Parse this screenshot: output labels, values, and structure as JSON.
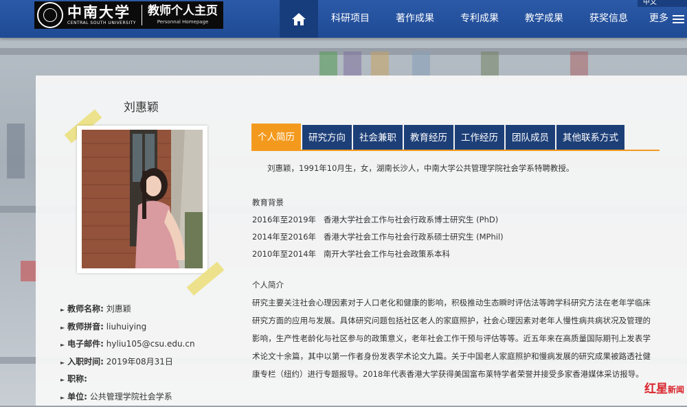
{
  "header": {
    "logo_cn": "中南大学",
    "logo_en": "CENTRAL SOUTH UNIVERSITY",
    "site_title": "教师个人主页",
    "site_title_en": "Personnal Homepage",
    "lang": "中文",
    "home_icon": "home-icon",
    "nav": [
      "科研项目",
      "著作成果",
      "专利成果",
      "教学成果",
      "获奖信息"
    ],
    "more": "更多",
    "colors": {
      "nav_bg": "#2b5aa8",
      "home_bg": "#173d7d"
    }
  },
  "profile": {
    "name": "刘惠颖",
    "fields": [
      {
        "label": "教师名称:",
        "value": "刘惠颖"
      },
      {
        "label": "教师拼音:",
        "value": "liuhuiying"
      },
      {
        "label": "电子邮件:",
        "value": "hyliu105@csu.edu.cn"
      },
      {
        "label": "入职时间:",
        "value": "2019年08月31日"
      },
      {
        "label": "职称:",
        "value": ""
      },
      {
        "label": "单位:",
        "value": "公共管理学院社会学系"
      }
    ]
  },
  "tabs": [
    "个人简历",
    "研究方向",
    "社会兼职",
    "教育经历",
    "工作经历",
    "团队成员",
    "其他联系方式"
  ],
  "active_tab": "个人简历",
  "resume": {
    "intro": "刘惠颖，1991年10月生，女，湖南长沙人，中南大学公共管理学院社会学系特聘教授。",
    "edu_title": "教育背景",
    "edu": [
      "2016年至2019年   香港大学社会工作与社会行政系博士研究生 (PhD)",
      "2014年至2016年   香港大学社会工作与社会行政系硕士研究生 (MPhil)",
      "2010年至2014年   南开大学社会工作与社会政策系本科"
    ],
    "bio_title": "个人简介",
    "bio": "研究主要关注社会心理因素对于人口老化和健康的影响，积极推动生态瞬时评估法等跨学科研究方法在老年学临床研究方面的应用与发展。具体研究问题包括社区老人的家庭照护，社会心理因素对老年人慢性病共病状况及管理的影响，生产性老龄化与社区参与的政策意义，老年社会工作干预与评估等等。近五年来在高质量国际期刊上发表学术论文十余篇，其中以第一作者身份发表学术论文九篇。关于中国老人家庭照护和慢病发展的研究成果被路透社健康专栏（纽约）进行专题报导。2018年代表香港大学获得美国富布莱特学者荣誉并接受多家香港媒体采访报导。"
  },
  "watermark": {
    "main": "红星",
    "sub": "新闻"
  },
  "accent": "#f39a1e"
}
